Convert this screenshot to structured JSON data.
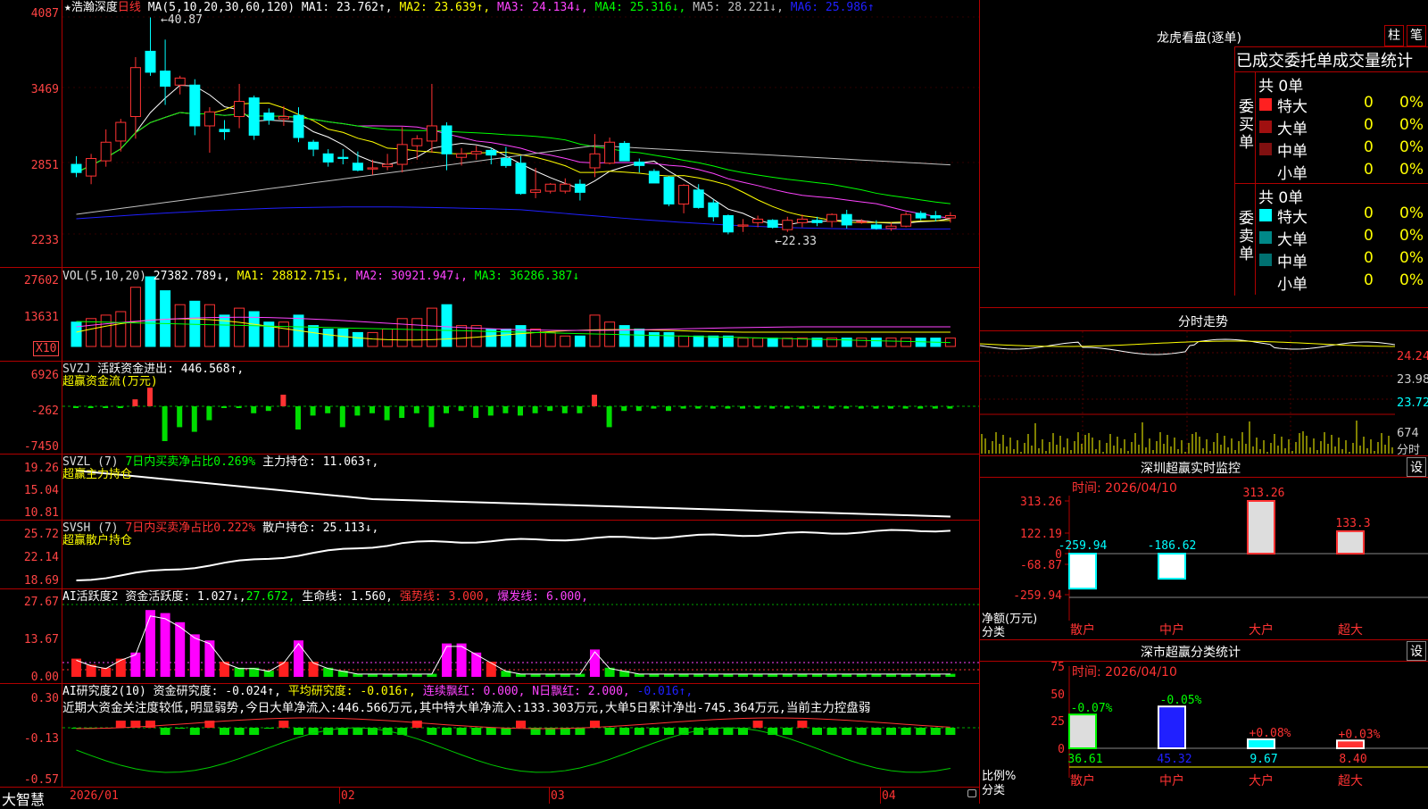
{
  "colors": {
    "up": "#ff3333",
    "down": "#00ffff",
    "grid": "#b00000",
    "ma1": "#ffffff",
    "ma2": "#ffff00",
    "ma3": "#ff44ff",
    "ma4": "#00ff00",
    "ma5": "#c0c0c0",
    "ma6": "#2020ff"
  },
  "main": {
    "axis": [
      "4087",
      "3469",
      "2851",
      "2233"
    ],
    "title_star": "★",
    "stock_name": "浩瀚深度",
    "period": "日线",
    "ma_params": "MA(5,10,20,30,60,120)",
    "ma1": "MA1: 23.762↑,",
    "ma2": "MA2: 23.639↑,",
    "ma3": "MA3: 24.134↓,",
    "ma4": "MA4: 25.316↓,",
    "ma5": "MA5: 28.221↓,",
    "ma6": "MA6: 25.986↑",
    "high_label": "40.87",
    "low_label": "22.33",
    "candles": [
      [
        28.3,
        29.0,
        27.2,
        27.6
      ],
      [
        27.3,
        29.2,
        26.6,
        28.8
      ],
      [
        28.6,
        31.3,
        28.1,
        30.2
      ],
      [
        30.3,
        32.2,
        29.4,
        31.9
      ],
      [
        32.4,
        37.5,
        30.5,
        36.6
      ],
      [
        38.0,
        40.9,
        35.9,
        36.2
      ],
      [
        36.3,
        39.0,
        33.4,
        35.0
      ],
      [
        35.1,
        35.9,
        34.3,
        35.7
      ],
      [
        35.1,
        35.6,
        30.8,
        31.6
      ],
      [
        31.6,
        33.2,
        29.3,
        32.8
      ],
      [
        31.3,
        32.1,
        30.4,
        31.1
      ],
      [
        32.4,
        35.2,
        31.4,
        33.7
      ],
      [
        34.0,
        34.2,
        30.4,
        30.8
      ],
      [
        32.7,
        33.1,
        31.7,
        32.1
      ],
      [
        32.2,
        33.3,
        31.6,
        32.4
      ],
      [
        32.5,
        33.2,
        30.2,
        30.6
      ],
      [
        30.2,
        30.4,
        29.0,
        29.6
      ],
      [
        29.2,
        29.6,
        28.1,
        28.5
      ],
      [
        28.9,
        29.6,
        28.3,
        28.8
      ],
      [
        28.4,
        29.4,
        27.7,
        27.8
      ],
      [
        27.9,
        28.7,
        27.4,
        28.0
      ],
      [
        28.1,
        29.2,
        27.8,
        28.3
      ],
      [
        28.3,
        31.5,
        27.6,
        30.0
      ],
      [
        29.9,
        30.8,
        28.7,
        30.5
      ],
      [
        30.3,
        35.2,
        29.3,
        31.6
      ],
      [
        31.6,
        31.9,
        27.8,
        29.2
      ],
      [
        28.9,
        29.7,
        28.2,
        29.2
      ],
      [
        29.2,
        29.9,
        28.7,
        29.4
      ],
      [
        29.5,
        29.7,
        28.3,
        29.1
      ],
      [
        28.8,
        29.8,
        28.0,
        28.2
      ],
      [
        28.4,
        29.0,
        25.7,
        25.8
      ],
      [
        25.9,
        28.0,
        25.4,
        26.1
      ],
      [
        26.0,
        26.7,
        25.8,
        26.6
      ],
      [
        26.0,
        27.1,
        25.8,
        26.6
      ],
      [
        26.6,
        27.0,
        25.2,
        25.9
      ],
      [
        28.0,
        30.9,
        27.2,
        29.2
      ],
      [
        28.4,
        30.6,
        28.3,
        30.2
      ],
      [
        30.1,
        30.3,
        28.6,
        28.6
      ],
      [
        28.5,
        28.8,
        27.6,
        28.2
      ],
      [
        27.7,
        27.9,
        26.7,
        26.7
      ],
      [
        27.2,
        27.3,
        24.7,
        24.9
      ],
      [
        24.9,
        26.6,
        24.1,
        26.5
      ],
      [
        26.1,
        26.6,
        24.5,
        24.6
      ],
      [
        25.0,
        25.3,
        23.4,
        23.8
      ],
      [
        23.9,
        24.0,
        22.3,
        22.5
      ],
      [
        23.0,
        23.6,
        22.5,
        23.1
      ],
      [
        23.3,
        23.9,
        22.9,
        23.6
      ],
      [
        23.5,
        23.6,
        22.8,
        22.9
      ],
      [
        22.7,
        23.8,
        22.5,
        23.5
      ],
      [
        23.3,
        24.0,
        22.9,
        23.6
      ],
      [
        23.5,
        23.8,
        23.0,
        23.3
      ],
      [
        23.4,
        24.1,
        22.9,
        24.0
      ],
      [
        24.0,
        24.4,
        22.8,
        23.1
      ],
      [
        23.4,
        23.6,
        23.2,
        23.4
      ],
      [
        23.1,
        23.5,
        22.7,
        22.8
      ],
      [
        22.8,
        23.3,
        22.6,
        23.0
      ],
      [
        23.0,
        24.2,
        22.9,
        24.0
      ],
      [
        24.1,
        24.3,
        23.5,
        23.7
      ],
      [
        23.9,
        24.3,
        23.4,
        23.7
      ],
      [
        23.7,
        24.2,
        23.3,
        23.9
      ]
    ]
  },
  "vol": {
    "axis": [
      "27602",
      "13631",
      "X10"
    ],
    "title": "VOL(5,10,20)",
    "value": "27382.789↓,",
    "ma1": "MA1: 28812.715↓,",
    "ma2": "MA2: 30921.947↓,",
    "ma3": "MA3: 36286.387↓"
  },
  "svzj": {
    "axis": [
      "6926",
      "-262",
      "-7450"
    ],
    "title": "SVZJ",
    "text": "活跃资金进出: 446.568↑,",
    "subtitle": "超赢资金流(万元)"
  },
  "svzl": {
    "axis": [
      "19.26",
      "15.04",
      "10.81"
    ],
    "title": "SVZL (7)",
    "text1": "7日内买卖净占比0.269%",
    "text2": "主力持仓: 11.063↑,",
    "subtitle": "超赢主力持仓"
  },
  "svsh": {
    "axis": [
      "25.72",
      "22.14",
      "18.69"
    ],
    "title": "SVSH (7)",
    "text1": "7日内买卖净占比0.222%",
    "text2": "散户持仓: 25.113↓,",
    "subtitle": "超赢散户持仓"
  },
  "ai1": {
    "axis": [
      "27.67",
      "13.67",
      "0.00"
    ],
    "title": "AI活跃度2",
    "t1": "资金活跃度: 1.027↓,",
    "t2": "27.672,",
    "t3": "生命线: 1.560,",
    "t4": "强势线: 3.000,",
    "t5": "爆发线: 6.000,"
  },
  "ai2": {
    "axis": [
      "0.30",
      "-0.13",
      "-0.57"
    ],
    "title": "AI研究度2(10)",
    "t1": "资金研究度: -0.024↑,",
    "t2": "平均研究度: -0.016↑,",
    "t3": "连续飘红: 0.000,",
    "t4": "N日飘红: 2.000,",
    "t5": "-0.016↑,",
    "summary": "近期大资金关注度较低,明显弱势,今日大单净流入:446.566万元,其中特大单净流入:133.303万元,大单5日累计净出-745.364万元,当前主力控盘弱"
  },
  "xaxis": {
    "brand": "大智慧",
    "labels": [
      "2026/01",
      "02",
      "03",
      "04"
    ]
  },
  "dragon": {
    "title": "龙虎看盘(逐单)",
    "btn_zhu": "柱",
    "btn_bi": "笔",
    "header": "已成交委托单成交量统计",
    "buy_label": "委买单",
    "sell_label": "委卖单",
    "buy_total": "共 0单",
    "sell_total": "共 0单",
    "buy_rows": [
      {
        "label": "特大",
        "val": "0",
        "pct": "0%",
        "color": "#ff2020"
      },
      {
        "label": "大单",
        "val": "0",
        "pct": "0%",
        "color": "#a01010"
      },
      {
        "label": "中单",
        "val": "0",
        "pct": "0%",
        "color": "#801010"
      },
      {
        "label": "小单",
        "val": "0",
        "pct": "0%",
        "color": ""
      }
    ],
    "sell_rows": [
      {
        "label": "特大",
        "val": "0",
        "pct": "0%",
        "color": "#00ffff"
      },
      {
        "label": "大单",
        "val": "0",
        "pct": "0%",
        "color": "#008888"
      },
      {
        "label": "中单",
        "val": "0",
        "pct": "0%",
        "color": "#007070"
      },
      {
        "label": "小单",
        "val": "0",
        "pct": "0%",
        "color": ""
      }
    ]
  },
  "intraday": {
    "title": "分时走势",
    "axis": [
      "24.24",
      "23.98",
      "23.72"
    ],
    "vol_axis": [
      "674",
      "分时"
    ]
  },
  "monitor": {
    "title": "深圳超赢实时监控",
    "btn": "设",
    "time": "时间: 2026/04/10",
    "axis": [
      "313.26",
      "122.19",
      "0",
      "-68.87",
      "-259.94"
    ],
    "ylabel1": "净额(万元)",
    "ylabel2": "分类",
    "bars": [
      {
        "cat": "散户",
        "label": "-259.94",
        "value": -259.94
      },
      {
        "cat": "中户",
        "label": "-186.62",
        "value": -186.62
      },
      {
        "cat": "大户",
        "label": "313.26",
        "value": 313.26
      },
      {
        "cat": "超大",
        "label": "133.3",
        "value": 133.3
      }
    ]
  },
  "classify": {
    "title": "深市超赢分类统计",
    "btn": "设",
    "time": "时间: 2026/04/10",
    "axis": [
      "75",
      "50",
      "25",
      "0"
    ],
    "ylabel1": "比例%",
    "ylabel2": "分类",
    "bars": [
      {
        "cat": "散户",
        "change": "-0.07%",
        "value": "36.61",
        "v": 36.61
      },
      {
        "cat": "中户",
        "change": "-0.05%",
        "value": "45.32",
        "v": 45.32
      },
      {
        "cat": "大户",
        "change": "+0.08%",
        "value": "9.67",
        "v": 9.67
      },
      {
        "cat": "超大",
        "change": "+0.03%",
        "value": "8.40",
        "v": 8.4
      }
    ]
  }
}
